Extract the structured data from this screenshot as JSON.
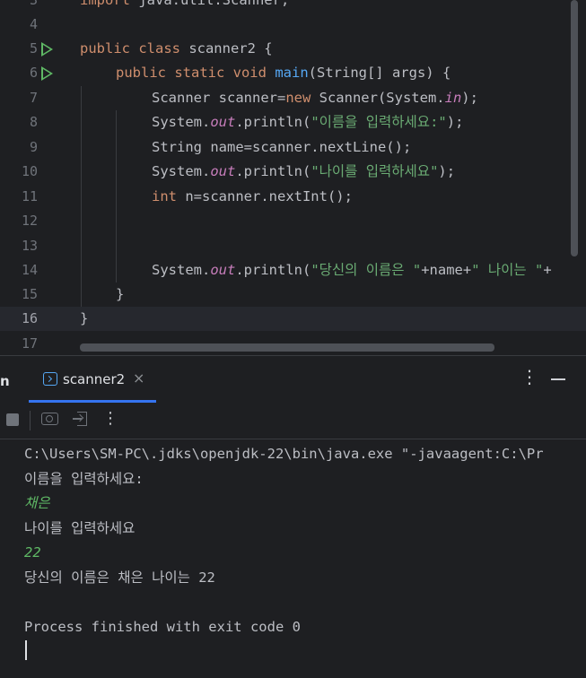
{
  "editor": {
    "lines": [
      {
        "n": "3",
        "text": "import java.util.Scanner;"
      },
      {
        "n": "4",
        "text": ""
      },
      {
        "n": "5",
        "text": "public class scanner2 {"
      },
      {
        "n": "6",
        "text": "public static void main(String[] args) {"
      },
      {
        "n": "7",
        "text": "Scanner scanner=new Scanner(System.in);"
      },
      {
        "n": "8",
        "text": "System.out.println(\"이름을 입력하세요:\");"
      },
      {
        "n": "9",
        "text": "String name=scanner.nextLine();"
      },
      {
        "n": "10",
        "text": "System.out.println(\"나이를 입력하세요\");"
      },
      {
        "n": "11",
        "text": "int n=scanner.nextInt();"
      },
      {
        "n": "12",
        "text": ""
      },
      {
        "n": "13",
        "text": ""
      },
      {
        "n": "14",
        "text": "System.out.println(\"당신의 이름은 \"+name+\" 나이는 \"+"
      },
      {
        "n": "15",
        "text": "}"
      },
      {
        "n": "16",
        "text": "}"
      },
      {
        "n": "17",
        "text": ""
      }
    ],
    "current_line": "16"
  },
  "run_panel": {
    "left_tab_fragment": "n",
    "tab_label": "scanner2",
    "close_glyph": "×",
    "more_glyph": "⋮"
  },
  "console": {
    "lines": [
      {
        "text": "C:\\Users\\SM-PC\\.jdks\\openjdk-22\\bin\\java.exe \"-javaagent:C:\\Pr",
        "type": "output"
      },
      {
        "text": "이름을 입력하세요:",
        "type": "output"
      },
      {
        "text": "채은",
        "type": "input"
      },
      {
        "text": "나이를 입력하세요",
        "type": "output"
      },
      {
        "text": "22",
        "type": "input"
      },
      {
        "text": "당신의 이름은 채은 나이는 22",
        "type": "output"
      },
      {
        "text": "",
        "type": "output"
      },
      {
        "text": "Process finished with exit code 0",
        "type": "output"
      }
    ]
  },
  "colors": {
    "background": "#1e1f22",
    "keyword": "#cf8e6d",
    "string": "#6aab73",
    "function": "#56a8f5",
    "field": "#c77dbb",
    "run_icon": "#5fb865",
    "tab_underline": "#3574f0"
  },
  "icons": [
    "run-gutter-icon",
    "console-tab-icon",
    "close-icon",
    "more-icon",
    "minimize-icon",
    "stop-icon",
    "screenshot-icon",
    "restore-layout-icon"
  ]
}
